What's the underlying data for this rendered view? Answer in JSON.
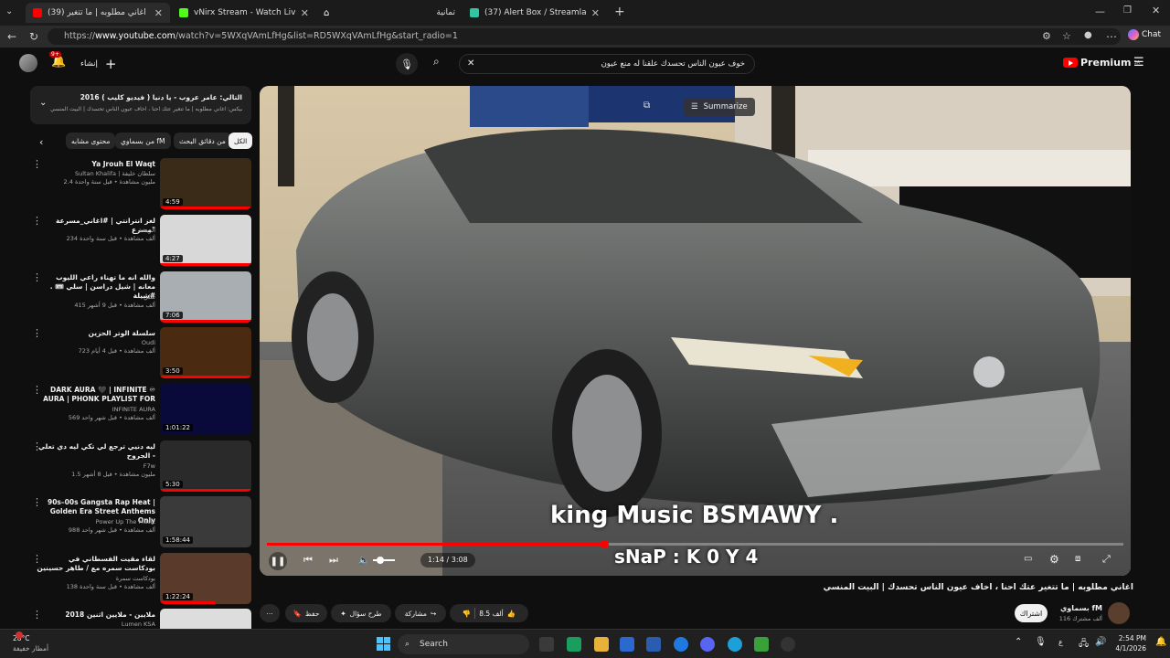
{
  "browser": {
    "tabs": [
      {
        "label": "(39) اغاني مطلوبه | ما تتغير",
        "active": true
      },
      {
        "label": "vNirx Stream - Watch Live on Kick",
        "active": false
      },
      {
        "label": "",
        "active": false
      },
      {
        "label": "تمانية",
        "active": false
      },
      {
        "label": "(37) Alert Box / Streamlabs",
        "active": false
      }
    ],
    "url_prefix": "https://",
    "url_domain": "www.youtube.com",
    "url_rest": "/watch?v=5WXqVAmLfHg&list=RD5WXqVAmLfHg&start_radio=1",
    "chat_label": "Chat"
  },
  "youtube": {
    "create_label": "إنشاء",
    "notification_count": "9+",
    "search_query": "خوف عيون الناس تحسدك علقنا له منع عيون",
    "premium_label": "Premium",
    "country": "SA",
    "summarize_label": "Summarize",
    "queue_title": "التالي: عامر عروب - يا دنيا ( فيديو كليب ) 2016",
    "queue_subtitle": "ميكس: اغاني مطلوبه | ما تتغير عتك احنا ، اخاف عيون الناس تحسدك | البيت المنسي",
    "chips": [
      "الكل",
      "من دقائق البحث",
      "من بسماوي fM",
      "محتوى مشابه"
    ],
    "video_title": "اغاني مطلوبه | ما تتغير عتك احنا ، اخاف عيون الناس تحسدك | البيت المنسي",
    "channel_name": "بسماوي fM",
    "subscribers": "116 ألف مشترك",
    "subscribe_label": "اشتراك",
    "likes": "8.5 ألف",
    "share_label": "مشاركة",
    "ask_label": "طرح سؤال",
    "save_label": "حفظ",
    "overlay_line1": "king Music BSMAWY .",
    "overlay_line2": "sNaP : K 0 Y 4",
    "time_display": "1:14 / 3:08",
    "progress_fraction": 0.394
  },
  "sidebar_videos": [
    {
      "title": "Ya Jrouh El Waqt",
      "channel": "Sultan Khalifa | سلطان خليفة",
      "meta": "2.4 مليون مشاهدة • قبل سنة واحدة",
      "duration": "4:59",
      "color": "#3a2a18",
      "progress": 1.0
    },
    {
      "title": "لغز انترانتي | #اغاني_مسرعة \"مسرع",
      "channel": "الريشة",
      "meta": "234 ألف مشاهدة • قبل سنة واحدة",
      "duration": "4:27",
      "color": "#d8d8d8",
      "progress": 1.0
    },
    {
      "title": "والله انه ما تهناء راعي الليوب معانه | شيل دراسن | سلي 🎟 . #شيلة",
      "channel": "سلي",
      "meta": "415 ألف مشاهدة • قبل 9 أشهر",
      "duration": "7:06",
      "color": "#a9aeb3",
      "progress": 1.0
    },
    {
      "title": "سلسلة الوتر الحزين",
      "channel": "Oudi",
      "meta": "723 ألف مشاهدة • قبل 4 أيام",
      "duration": "3:50",
      "color": "#4a2a10",
      "progress": 1.0
    },
    {
      "title": "DARK AURA 🖤 | INFINITE ♾ AURA | PHONK PLAYLIST FOR",
      "channel": "INFINITE AURA",
      "meta": "569 ألف مشاهدة • قبل شهر واحد",
      "duration": "1:01:22",
      "color": "#0a0a3a",
      "progress": 0
    },
    {
      "title": "ليه دنيي ترجع لي تكي ليه دي تعلي الجروح -",
      "channel": "F7w",
      "meta": "1.5 مليون مشاهدة • قبل 8 أشهر",
      "duration": "5:30",
      "color": "#2a2a2a",
      "progress": 1.0
    },
    {
      "title": "90s–00s Gangsta Rap Heat | Golden Era Street Anthems Only",
      "channel": "Power Up The Music",
      "meta": "988 ألف مشاهدة • قبل شهر واحد",
      "duration": "1:58:44",
      "color": "#3a3a3a",
      "progress": 0
    },
    {
      "title": "لقاء مقيت الفسطاني في بودكاست سمره مع / طاهر حسينين",
      "channel": "بودكاست سمرة",
      "meta": "138 ألف مشاهدة • قبل سنة واحدة",
      "duration": "1:22:24",
      "color": "#5a3a2a",
      "progress": 0.6
    },
    {
      "title": "ملايين - ملايين اثنين 2018",
      "channel": "Lumen KSA",
      "meta": "",
      "duration": "",
      "color": "#ddd",
      "progress": 0
    }
  ],
  "taskbar": {
    "weather_temp": "28°C",
    "weather_desc": "أمطار خفيفة",
    "search_label": "Search",
    "time": "2:54 PM",
    "date": "4/1/2026",
    "lang": "ع"
  }
}
